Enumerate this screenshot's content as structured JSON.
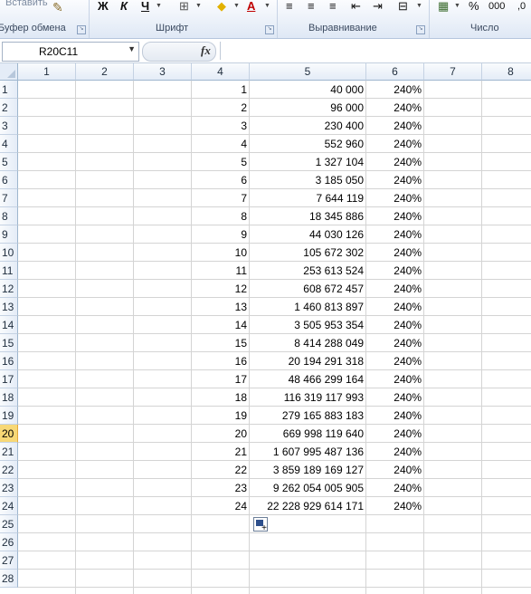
{
  "ribbon": {
    "paste_label": "Вставить",
    "groups": [
      {
        "label": "Буфер обмена"
      },
      {
        "label": "Шрифт"
      },
      {
        "label": "Выравнивание"
      },
      {
        "label": "Число"
      }
    ],
    "bold": "Ж",
    "italic": "К",
    "underline": "Ч",
    "percent": "%",
    "thousands": "000"
  },
  "formula_bar": {
    "name_box": "R20C11",
    "fx": "fx",
    "formula": ""
  },
  "columns": [
    "1",
    "2",
    "3",
    "4",
    "5",
    "6",
    "7",
    "8"
  ],
  "rows": [
    "1",
    "2",
    "3",
    "4",
    "5",
    "6",
    "7",
    "8",
    "9",
    "10",
    "11",
    "12",
    "13",
    "14",
    "15",
    "16",
    "17",
    "18",
    "19",
    "20",
    "21",
    "22",
    "23",
    "24",
    "25",
    "26",
    "27",
    "28"
  ],
  "active_row": "20",
  "data": [
    {
      "n": "1",
      "v": "40 000",
      "p": "240%"
    },
    {
      "n": "2",
      "v": "96 000",
      "p": "240%"
    },
    {
      "n": "3",
      "v": "230 400",
      "p": "240%"
    },
    {
      "n": "4",
      "v": "552 960",
      "p": "240%"
    },
    {
      "n": "5",
      "v": "1 327 104",
      "p": "240%"
    },
    {
      "n": "6",
      "v": "3 185 050",
      "p": "240%"
    },
    {
      "n": "7",
      "v": "7 644 119",
      "p": "240%"
    },
    {
      "n": "8",
      "v": "18 345 886",
      "p": "240%"
    },
    {
      "n": "9",
      "v": "44 030 126",
      "p": "240%"
    },
    {
      "n": "10",
      "v": "105 672 302",
      "p": "240%"
    },
    {
      "n": "11",
      "v": "253 613 524",
      "p": "240%"
    },
    {
      "n": "12",
      "v": "608 672 457",
      "p": "240%"
    },
    {
      "n": "13",
      "v": "1 460 813 897",
      "p": "240%"
    },
    {
      "n": "14",
      "v": "3 505 953 354",
      "p": "240%"
    },
    {
      "n": "15",
      "v": "8 414 288 049",
      "p": "240%"
    },
    {
      "n": "16",
      "v": "20 194 291 318",
      "p": "240%"
    },
    {
      "n": "17",
      "v": "48 466 299 164",
      "p": "240%"
    },
    {
      "n": "18",
      "v": "116 319 117 993",
      "p": "240%"
    },
    {
      "n": "19",
      "v": "279 165 883 183",
      "p": "240%"
    },
    {
      "n": "20",
      "v": "669 998 119 640",
      "p": "240%"
    },
    {
      "n": "21",
      "v": "1 607 995 487 136",
      "p": "240%"
    },
    {
      "n": "22",
      "v": "3 859 189 169 127",
      "p": "240%"
    },
    {
      "n": "23",
      "v": "9 262 054 005 905",
      "p": "240%"
    },
    {
      "n": "24",
      "v": "22 228 929 614 171",
      "p": "240%"
    }
  ]
}
